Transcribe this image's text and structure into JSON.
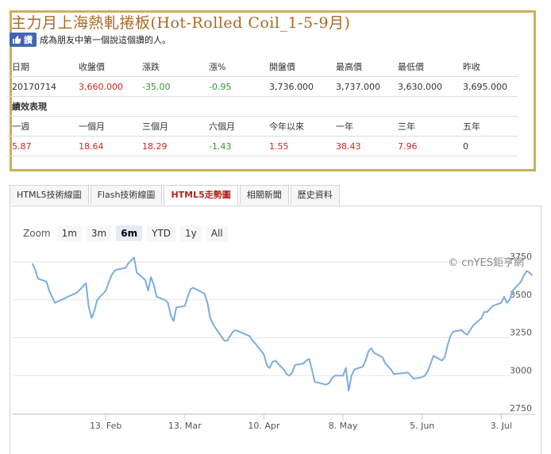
{
  "title": "主力月上海熱軋捲板(Hot-Rolled Coil_1-5-9月)",
  "like": {
    "button_label": "讚",
    "text": "成為朋友中第一個說這個讚的人。"
  },
  "quote": {
    "headers": [
      "日期",
      "收盤價",
      "漲跌",
      "漲%",
      "開盤價",
      "最高價",
      "最低價",
      "昨收"
    ],
    "values": [
      "20170714",
      "3,660.000",
      "-35.00",
      "-0.95",
      "3,736.000",
      "3,737.000",
      "3,630.000",
      "3,695.000"
    ]
  },
  "performance": {
    "section_label": "績效表現",
    "headers": [
      "一週",
      "一個月",
      "三個月",
      "六個月",
      "今年以來",
      "一年",
      "三年",
      "五年"
    ],
    "values": [
      "5.87",
      "18.64",
      "18.29",
      "-1.43",
      "1.55",
      "38.43",
      "7.96",
      "0"
    ]
  },
  "tabs": [
    "HTML5技術線圖",
    "Flash技術線圖",
    "HTML5走勢圖",
    "相關新聞",
    "歷史資料"
  ],
  "active_tab": 2,
  "zoom": {
    "label": "Zoom",
    "options": [
      "1m",
      "3m",
      "6m",
      "YTD",
      "1y",
      "All"
    ],
    "selected": 2
  },
  "chart_data": {
    "type": "line",
    "credit": "© cnYES鉅亨網",
    "x": [
      "2017-01-18",
      "2017-01-19",
      "2017-01-20",
      "2017-01-23",
      "2017-01-24",
      "2017-01-25",
      "2017-01-26",
      "2017-02-03",
      "2017-02-06",
      "2017-02-07",
      "2017-02-08",
      "2017-02-09",
      "2017-02-10",
      "2017-02-13",
      "2017-02-14",
      "2017-02-15",
      "2017-02-16",
      "2017-02-17",
      "2017-02-20",
      "2017-02-21",
      "2017-02-22",
      "2017-02-23",
      "2017-02-24",
      "2017-02-27",
      "2017-02-28",
      "2017-03-01",
      "2017-03-02",
      "2017-03-03",
      "2017-03-06",
      "2017-03-07",
      "2017-03-08",
      "2017-03-09",
      "2017-03-10",
      "2017-03-13",
      "2017-03-14",
      "2017-03-15",
      "2017-03-16",
      "2017-03-17",
      "2017-03-20",
      "2017-03-21",
      "2017-03-22",
      "2017-03-23",
      "2017-03-24",
      "2017-03-27",
      "2017-03-28",
      "2017-03-29",
      "2017-03-30",
      "2017-03-31",
      "2017-04-05",
      "2017-04-06",
      "2017-04-07",
      "2017-04-10",
      "2017-04-11",
      "2017-04-12",
      "2017-04-13",
      "2017-04-14",
      "2017-04-17",
      "2017-04-18",
      "2017-04-19",
      "2017-04-20",
      "2017-04-21",
      "2017-04-24",
      "2017-04-25",
      "2017-04-26",
      "2017-04-27",
      "2017-04-28",
      "2017-05-02",
      "2017-05-03",
      "2017-05-04",
      "2017-05-05",
      "2017-05-08",
      "2017-05-09",
      "2017-05-10",
      "2017-05-11",
      "2017-05-12",
      "2017-05-15",
      "2017-05-16",
      "2017-05-17",
      "2017-05-18",
      "2017-05-19",
      "2017-05-22",
      "2017-05-23",
      "2017-05-24",
      "2017-05-25",
      "2017-05-26",
      "2017-05-31",
      "2017-06-01",
      "2017-06-02",
      "2017-06-05",
      "2017-06-06",
      "2017-06-07",
      "2017-06-08",
      "2017-06-09",
      "2017-06-12",
      "2017-06-13",
      "2017-06-14",
      "2017-06-15",
      "2017-06-16",
      "2017-06-19",
      "2017-06-20",
      "2017-06-21",
      "2017-06-22",
      "2017-06-23",
      "2017-06-26",
      "2017-06-27",
      "2017-06-28",
      "2017-06-29",
      "2017-06-30",
      "2017-07-03",
      "2017-07-04",
      "2017-07-05",
      "2017-07-06",
      "2017-07-07",
      "2017-07-10",
      "2017-07-11",
      "2017-07-12",
      "2017-07-13",
      "2017-07-14"
    ],
    "y": [
      3740,
      3700,
      3640,
      3620,
      3560,
      3520,
      3480,
      3550,
      3610,
      3450,
      3380,
      3430,
      3500,
      3560,
      3610,
      3660,
      3690,
      3700,
      3710,
      3740,
      3760,
      3780,
      3680,
      3630,
      3560,
      3650,
      3600,
      3520,
      3500,
      3480,
      3400,
      3360,
      3450,
      3460,
      3520,
      3570,
      3580,
      3570,
      3540,
      3480,
      3380,
      3340,
      3310,
      3230,
      3230,
      3260,
      3290,
      3300,
      3260,
      3230,
      3210,
      3140,
      3070,
      3050,
      3090,
      3100,
      3040,
      3010,
      3000,
      3020,
      3070,
      3080,
      3100,
      3110,
      3040,
      2960,
      2940,
      2950,
      2980,
      3000,
      3000,
      3050,
      2900,
      3000,
      3040,
      3060,
      3100,
      3160,
      3180,
      3150,
      3120,
      3080,
      3060,
      3040,
      3010,
      3020,
      3000,
      2980,
      2990,
      3000,
      3030,
      3080,
      3130,
      3100,
      3120,
      3200,
      3260,
      3290,
      3300,
      3280,
      3270,
      3300,
      3330,
      3380,
      3420,
      3420,
      3440,
      3460,
      3480,
      3520,
      3480,
      3500,
      3560,
      3620,
      3660,
      3690,
      3680,
      3660
    ],
    "x_tick_labels": [
      "13. Feb",
      "13. Mar",
      "10. Apr",
      "8. May",
      "5. Jun",
      "3. Jul"
    ],
    "x_tick_dates": [
      "2017-02-13",
      "2017-03-13",
      "2017-04-10",
      "2017-05-08",
      "2017-06-05",
      "2017-07-03"
    ],
    "y_ticks": [
      2750,
      3000,
      3250,
      3500,
      3750
    ],
    "ylim": [
      2750,
      3750
    ],
    "xlim": [
      "2017-01-15",
      "2017-07-15"
    ],
    "grid": true,
    "legend": "none",
    "line_color": "#7aaee0"
  }
}
